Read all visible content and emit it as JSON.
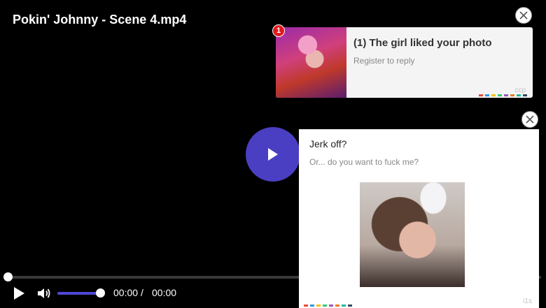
{
  "player": {
    "title": "Pokin' Johnny - Scene 4.mp4",
    "current_time": "00:00",
    "separator": "/",
    "duration": "00:00",
    "progress": 0,
    "volume": 1.0,
    "accent_color": "#4a3fc2"
  },
  "notification_ad": {
    "badge_count": "1",
    "title": "(1) The girl liked your photo",
    "subtitle": "Register to reply",
    "tag": "ccp"
  },
  "side_ad": {
    "title": "Jerk off?",
    "subtitle": "Or... do you want to fuck me?",
    "tag": "i1s"
  },
  "icons": {
    "big_play": "play-icon",
    "play": "play-icon",
    "volume": "volume-icon",
    "close": "close-icon"
  },
  "dot_colors": [
    "#e74c3c",
    "#3498db",
    "#f1c40f",
    "#2ecc71",
    "#9b59b6",
    "#e67e22",
    "#1abc9c",
    "#34495e"
  ]
}
